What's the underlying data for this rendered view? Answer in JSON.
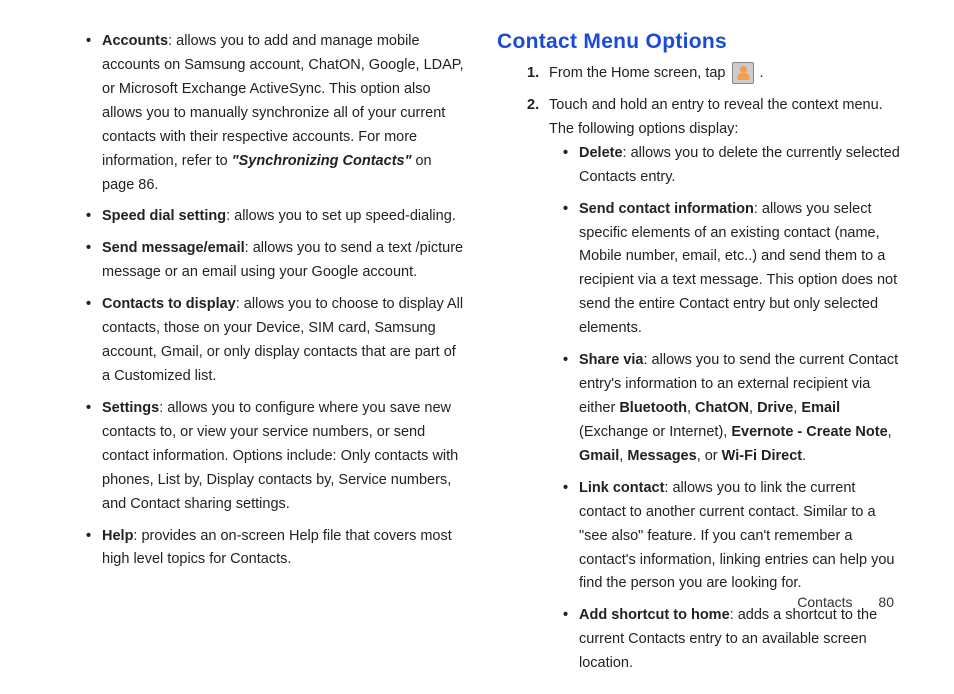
{
  "left": {
    "items": [
      {
        "label": "Accounts",
        "body1": ": allows you to add and manage mobile accounts on Samsung account, ChatON, Google, LDAP, or Microsoft Exchange ActiveSync. This option also allows you to manually synchronize all of your current contacts with their respective accounts. For more information, refer to ",
        "ref": "\"Synchronizing Contacts\"",
        "body2": " on page 86."
      },
      {
        "label": "Speed dial setting",
        "body1": ": allows you to set up speed-dialing."
      },
      {
        "label": "Send message/email",
        "body1": ": allows you to send a text /picture message or an email using your Google account."
      },
      {
        "label": "Contacts to display",
        "body1": ": allows you to choose to display All contacts, those on your Device, SIM card, Samsung account, Gmail, or only display contacts that are part of a Customized list."
      },
      {
        "label": "Settings",
        "body1": ": allows you to configure where you save new contacts to, or view your service numbers, or send contact information. Options include: Only contacts with phones, List by, Display contacts by, Service numbers, and Contact sharing settings."
      },
      {
        "label": "Help",
        "body1": ": provides an on-screen Help file that covers most high level topics for Contacts."
      }
    ]
  },
  "right": {
    "heading": "Contact Menu Options",
    "step1": {
      "num": "1.",
      "text": "From the Home screen, tap ",
      "after": " ."
    },
    "step2": {
      "num": "2.",
      "text": "Touch and hold an entry to reveal the context menu. The following options display:"
    },
    "sub": [
      {
        "label": "Delete",
        "body1": ": allows you to delete the currently selected Contacts entry."
      },
      {
        "label": "Send contact information",
        "body1": ": allows you select specific elements of an existing contact (name, Mobile number, email, etc..) and send them to a recipient via a text message. This option does not send the entire Contact entry but only selected elements."
      },
      {
        "label": "Share via",
        "body1": ": allows you to send the current Contact entry's information to an external recipient via either ",
        "b1": "Bluetooth",
        "c1": ", ",
        "b2": "ChatON",
        "c2": ", ",
        "b3": "Drive",
        "c3": ", ",
        "b4": "Email",
        "c4": " (Exchange or Internet), ",
        "b5": "Evernote - Create Note",
        "c5": ", ",
        "b6": "Gmail",
        "c6": ", ",
        "b7": "Messages",
        "c7": ", or ",
        "b8": "Wi-Fi Direct",
        "c8": "."
      },
      {
        "label": "Link contact",
        "body1": ": allows you to link the current contact to another current contact. Similar to a \"see also\" feature. If you can't remember a contact's information, linking entries can help you find the person you are looking for."
      },
      {
        "label": "Add shortcut to home",
        "body1": ": adds a shortcut to the current Contacts entry to an available screen location."
      }
    ]
  },
  "footer": {
    "section": "Contacts",
    "page": "80"
  }
}
